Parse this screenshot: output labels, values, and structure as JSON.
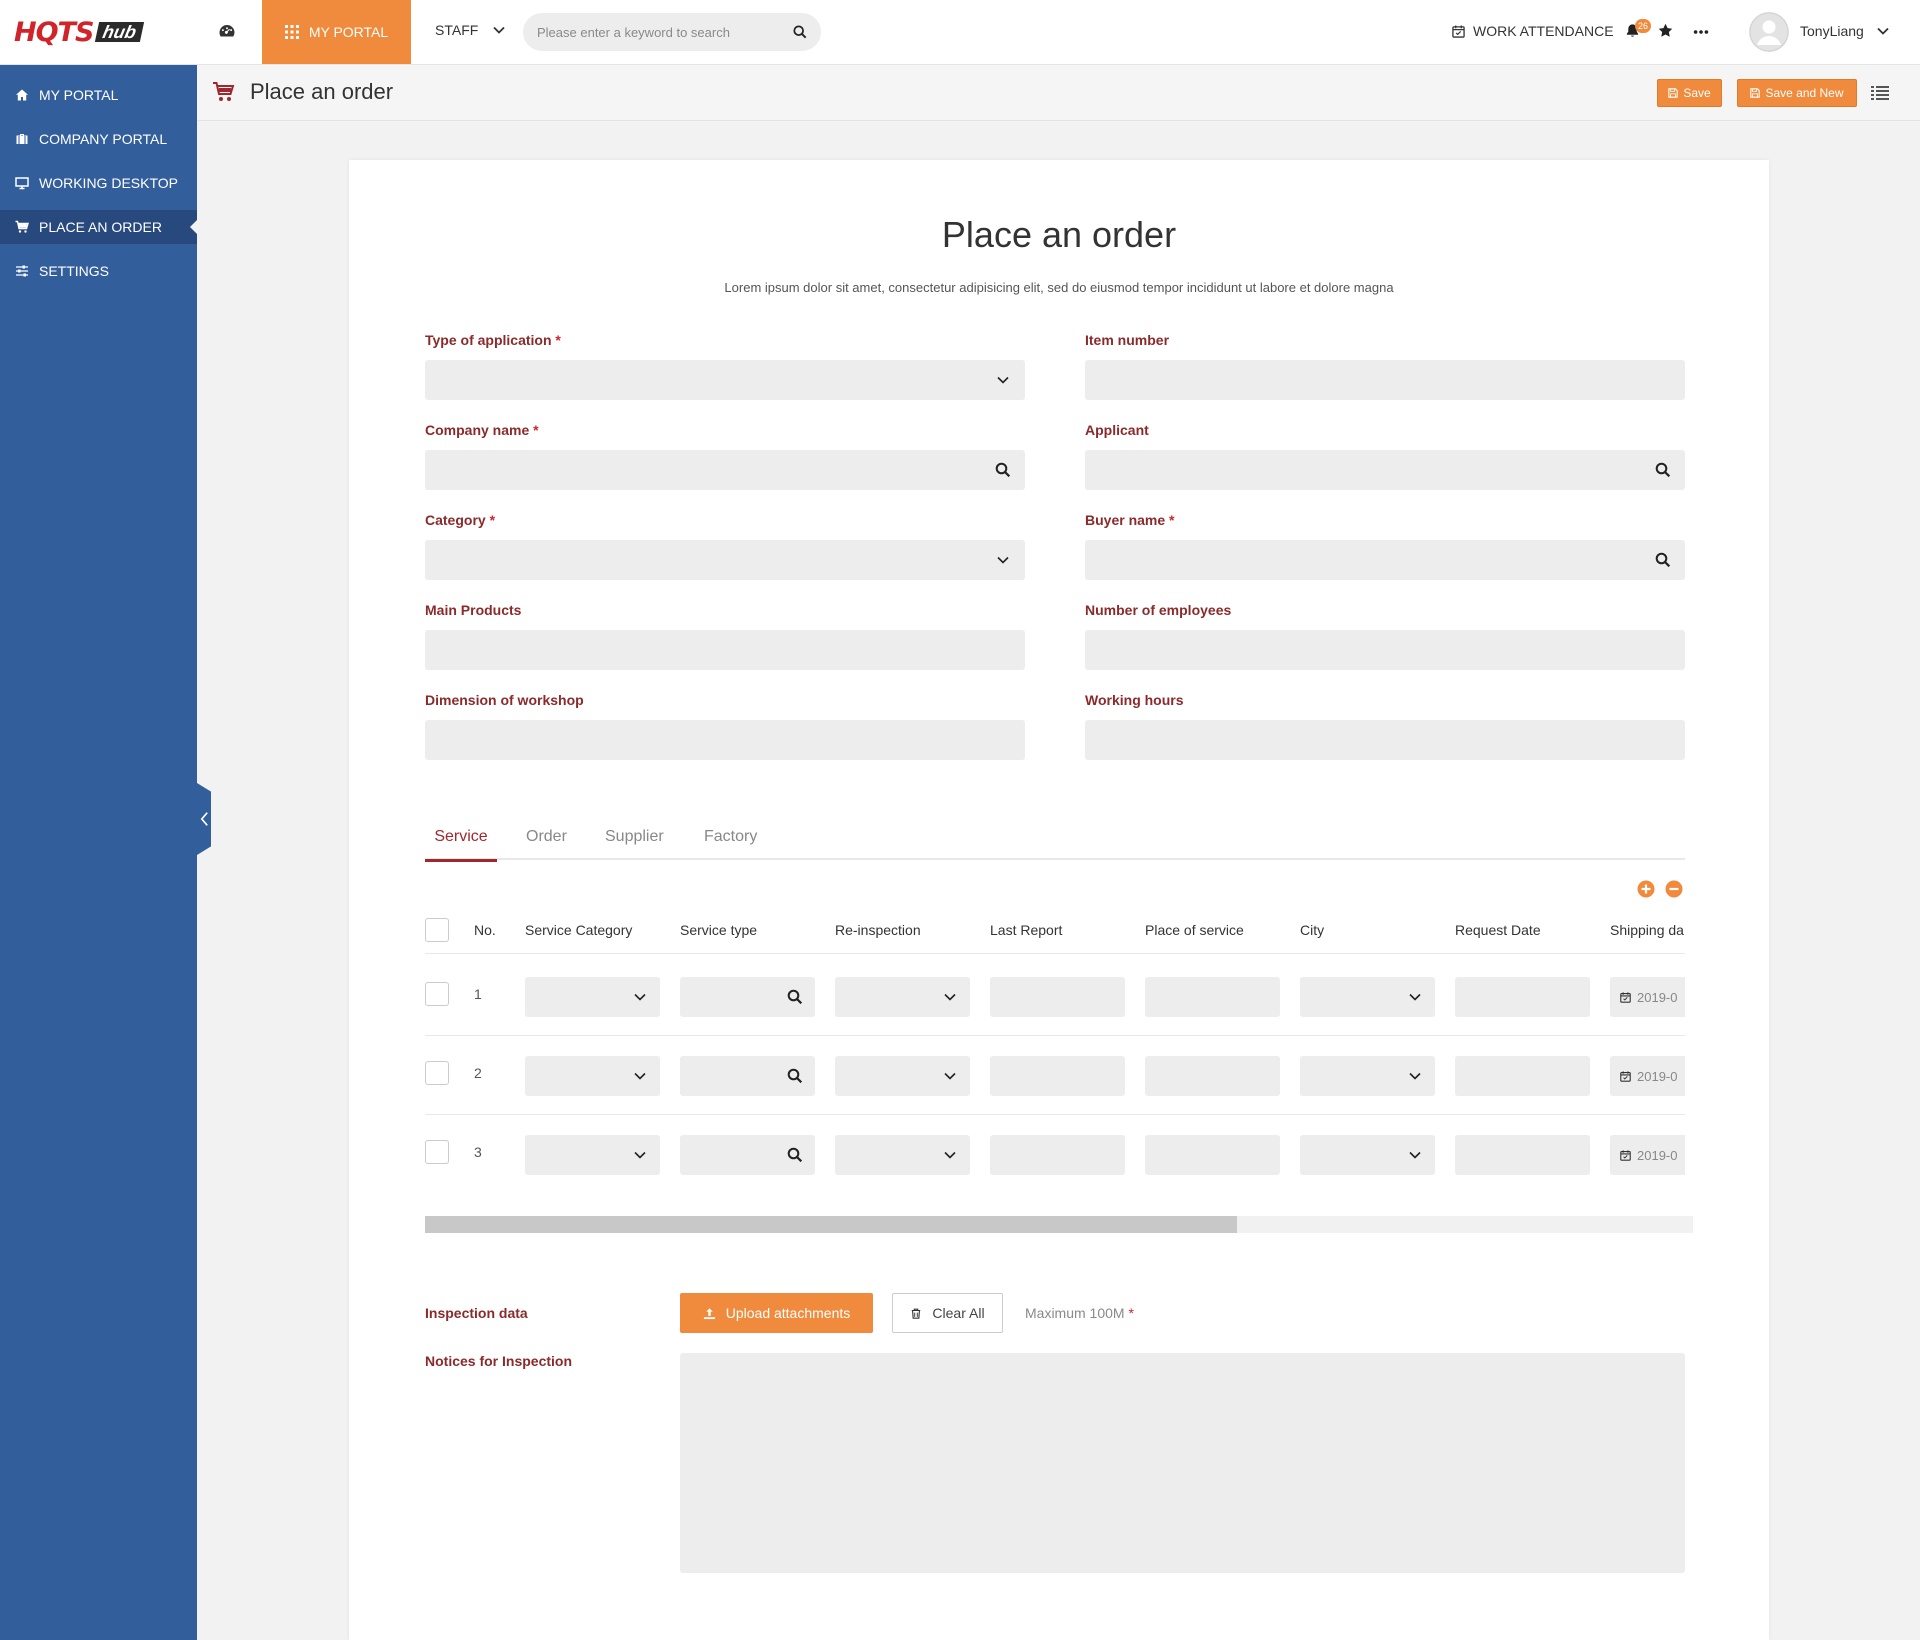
{
  "topbar": {
    "logo_main": "HQTS",
    "logo_sub": "hub",
    "my_portal": "MY PORTAL",
    "staff": "STAFF",
    "search_placeholder": "Please enter a keyword to search",
    "work_attendance": "WORK ATTENDANCE",
    "notification_count": "26",
    "username": "TonyLiang"
  },
  "sidebar": {
    "items": [
      {
        "label": "MY PORTAL",
        "icon": "home-icon"
      },
      {
        "label": "COMPANY PORTAL",
        "icon": "briefcase-icon"
      },
      {
        "label": "WORKING DESKTOP",
        "icon": "desktop-icon"
      },
      {
        "label": "PLACE AN ORDER",
        "icon": "cart-icon",
        "active": true
      },
      {
        "label": "SETTINGS",
        "icon": "sliders-icon"
      }
    ]
  },
  "pageheader": {
    "title": "Place an order",
    "save": "Save",
    "save_and_new": "Save and New"
  },
  "form": {
    "title": "Place an order",
    "subtitle": "Lorem ipsum dolor sit amet, consectetur adipisicing elit, sed do eiusmod tempor incididunt ut labore et dolore magna",
    "fields": {
      "type_of_application": "Type of application",
      "item_number": "Item number",
      "company_name": "Company name",
      "applicant": "Applicant",
      "category": "Category",
      "buyer_name": "Buyer name",
      "main_products": "Main Products",
      "number_of_employees": "Number of employees",
      "dimension_of_workshop": "Dimension of workshop",
      "working_hours": "Working hours"
    },
    "required_mark": "*"
  },
  "tabs": [
    "Service",
    "Order",
    "Supplier",
    "Factory"
  ],
  "table": {
    "headers": [
      "No.",
      "Service Category",
      "Service type",
      "Re-inspection",
      "Last Report",
      "Place of service",
      "City",
      "Request Date",
      "Shipping da"
    ],
    "rows": [
      {
        "no": "1",
        "shipping_date": "2019-0"
      },
      {
        "no": "2",
        "shipping_date": "2019-0"
      },
      {
        "no": "3",
        "shipping_date": "2019-0"
      }
    ],
    "scroll_fraction": 0.64
  },
  "attachments": {
    "inspection_data": "Inspection data",
    "upload": "Upload attachments",
    "clear_all": "Clear All",
    "max_note": "Maximum 100M",
    "notices": "Notices for Inspection"
  },
  "colors": {
    "accent": "#f08a3c",
    "sidebar": "#335e9c",
    "label": "#8b2a2a"
  }
}
